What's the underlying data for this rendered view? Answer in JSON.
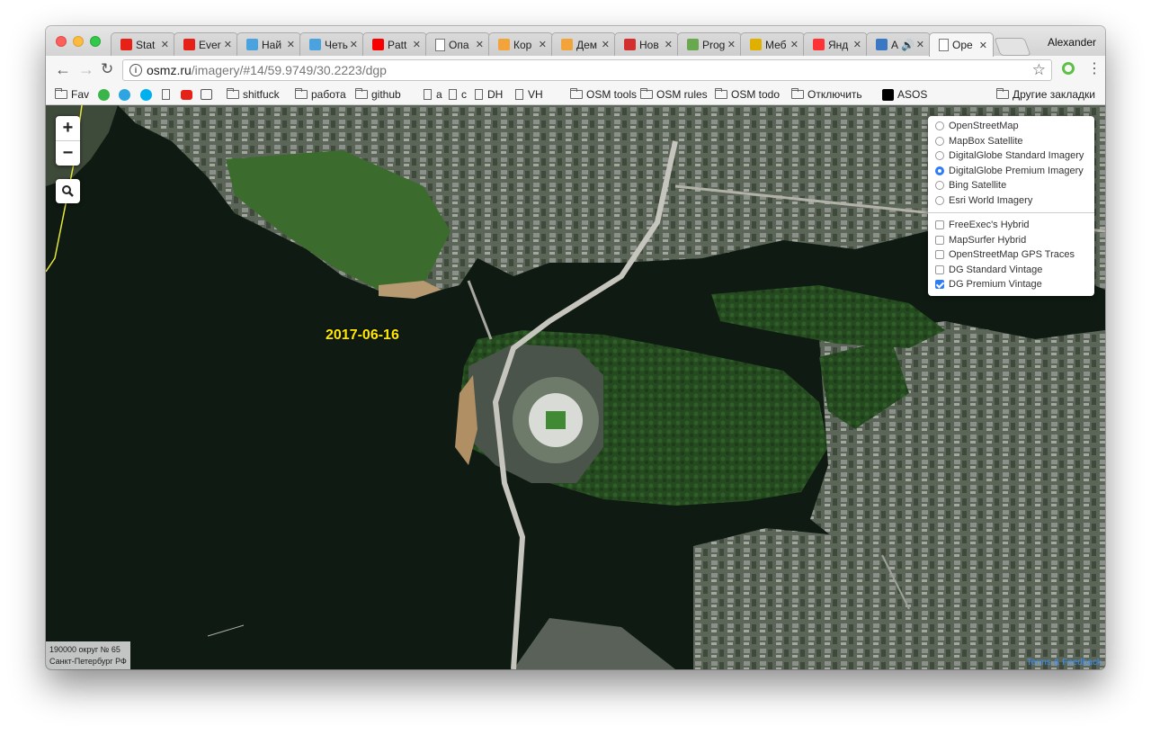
{
  "window": {
    "profile_name": "Alexander"
  },
  "tabs": [
    {
      "title": "Stat",
      "icon": "youtube-icon",
      "color": "#e62117"
    },
    {
      "title": "Ever",
      "icon": "youtube-icon",
      "color": "#e62117"
    },
    {
      "title": "Най",
      "icon": "h-icon",
      "color": "#4aa3df"
    },
    {
      "title": "Четы",
      "icon": "h-icon",
      "color": "#4aa3df"
    },
    {
      "title": "Patt",
      "icon": "oracle-icon",
      "color": "#f80000"
    },
    {
      "title": "Опа",
      "icon": "page-icon",
      "color": "#ffffff"
    },
    {
      "title": "Кор",
      "icon": "lion-icon",
      "color": "#f2a33a"
    },
    {
      "title": "Дем",
      "icon": "lion-icon",
      "color": "#f2a33a"
    },
    {
      "title": "Нов",
      "icon": "tv-icon",
      "color": "#d32f2f"
    },
    {
      "title": "Prog",
      "icon": "tools-icon",
      "color": "#6aa84f"
    },
    {
      "title": "Меб",
      "icon": "ruler-icon",
      "color": "#e0b000"
    },
    {
      "title": "Янд",
      "icon": "map-pin-icon",
      "color": "#ff3333"
    },
    {
      "title": "А 🔊",
      "icon": "play-icon",
      "color": "#3b78c4"
    },
    {
      "title": "Оре",
      "icon": "page-icon",
      "color": "#ffffff",
      "active": true
    }
  ],
  "toolbar": {
    "url_host": "osmz.ru",
    "url_path": "/imagery/#14/59.9749/30.2223/dgp"
  },
  "bookmarks": [
    {
      "label": "Fav",
      "type": "folder"
    },
    {
      "label": "",
      "type": "icon",
      "icon": "green-1-icon"
    },
    {
      "label": "",
      "type": "icon",
      "icon": "telegram-icon"
    },
    {
      "label": "",
      "type": "icon",
      "icon": "skype-icon"
    },
    {
      "label": "",
      "type": "icon",
      "icon": "page-icon"
    },
    {
      "label": "",
      "type": "icon",
      "icon": "youtube-icon"
    },
    {
      "label": "",
      "type": "icon",
      "icon": "drone-icon"
    },
    {
      "label": "shitfuck",
      "type": "folder"
    },
    {
      "label": "работа",
      "type": "folder"
    },
    {
      "label": "github",
      "type": "folder"
    },
    {
      "label": "a",
      "type": "page"
    },
    {
      "label": "c",
      "type": "page"
    },
    {
      "label": "DH",
      "type": "page"
    },
    {
      "label": "VH",
      "type": "page"
    },
    {
      "label": "OSM tools",
      "type": "folder"
    },
    {
      "label": "OSM rules",
      "type": "folder"
    },
    {
      "label": "OSM todo",
      "type": "folder"
    },
    {
      "label": "Отключить",
      "type": "folder"
    },
    {
      "label": "ASOS",
      "type": "asos"
    },
    {
      "label": "Другие закладки",
      "type": "folder"
    }
  ],
  "map": {
    "zoom_in_label": "+",
    "zoom_out_label": "−",
    "imagery_date": "2017-06-16",
    "district_line1": "190000 округ № 65",
    "district_line2": "Санкт-Петербург РФ",
    "attribution": "Terms & Feedback"
  },
  "layers": {
    "base": [
      {
        "label": "OpenStreetMap",
        "selected": false
      },
      {
        "label": "MapBox Satellite",
        "selected": false
      },
      {
        "label": "DigitalGlobe Standard Imagery",
        "selected": false
      },
      {
        "label": "DigitalGlobe Premium Imagery",
        "selected": true
      },
      {
        "label": "Bing Satellite",
        "selected": false
      },
      {
        "label": "Esri World Imagery",
        "selected": false
      }
    ],
    "overlays": [
      {
        "label": "FreeExec's Hybrid",
        "checked": false
      },
      {
        "label": "MapSurfer Hybrid",
        "checked": false
      },
      {
        "label": "OpenStreetMap GPS Traces",
        "checked": false
      },
      {
        "label": "DG Standard Vintage",
        "checked": false
      },
      {
        "label": "DG Premium Vintage",
        "checked": true
      }
    ]
  },
  "colors": {
    "water": "#0f1a12",
    "vegetation": "#2f5a2a",
    "accent_blue": "#2e7cf6",
    "date_label": "#ffe800"
  }
}
